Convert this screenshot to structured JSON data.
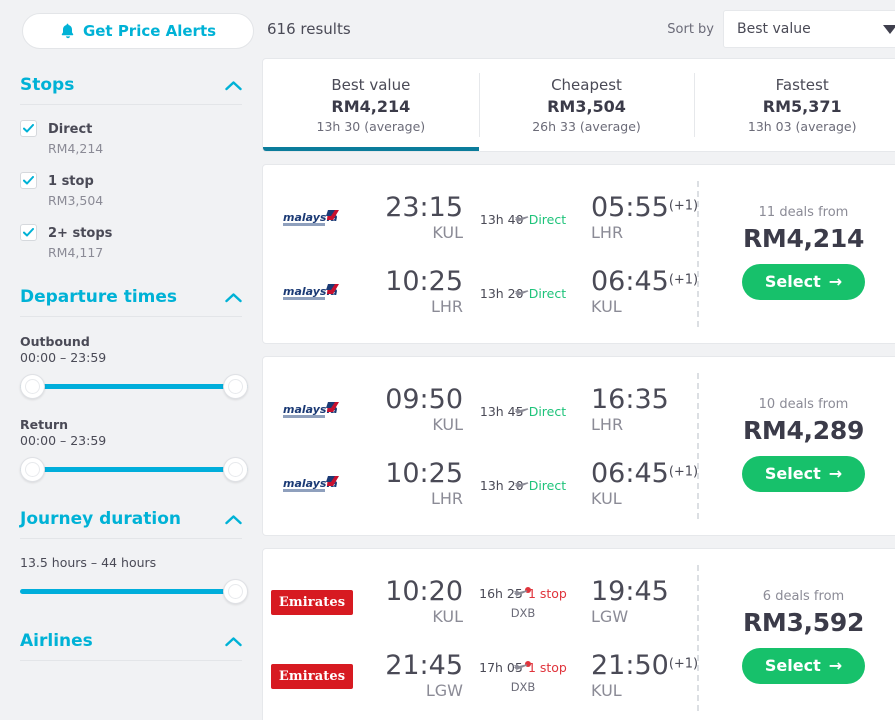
{
  "sidebar": {
    "price_alerts_label": "Get Price Alerts",
    "stops": {
      "title": "Stops",
      "options": [
        {
          "label": "Direct",
          "price": "RM4,214",
          "checked": true
        },
        {
          "label": "1 stop",
          "price": "RM3,504",
          "checked": true
        },
        {
          "label": "2+ stops",
          "price": "RM4,117",
          "checked": true
        }
      ]
    },
    "departure_times": {
      "title": "Departure times",
      "outbound_label": "Outbound",
      "outbound_range": "00:00 – 23:59",
      "return_label": "Return",
      "return_range": "00:00 – 23:59"
    },
    "journey_duration": {
      "title": "Journey duration",
      "range": "13.5 hours – 44 hours"
    },
    "airlines": {
      "title": "Airlines"
    }
  },
  "topbar": {
    "results_count": "616 results",
    "sort_by_label": "Sort by",
    "sort_value": "Best value"
  },
  "tabs": [
    {
      "label": "Best value",
      "price": "RM4,214",
      "duration": "13h 30 (average)",
      "active": true
    },
    {
      "label": "Cheapest",
      "price": "RM3,504",
      "duration": "26h 33 (average)",
      "active": false
    },
    {
      "label": "Fastest",
      "price": "RM5,371",
      "duration": "13h 03 (average)",
      "active": false
    }
  ],
  "results": [
    {
      "legs": [
        {
          "airline": "malaysia-airlines",
          "depart_time": "23:15",
          "depart_code": "KUL",
          "duration": "13h 40",
          "stops": "Direct",
          "stops_type": "direct",
          "via": "",
          "arrive_time": "05:55",
          "arrive_plus": "(+1)",
          "arrive_code": "LHR"
        },
        {
          "airline": "malaysia-airlines",
          "depart_time": "10:25",
          "depart_code": "LHR",
          "duration": "13h 20",
          "stops": "Direct",
          "stops_type": "direct",
          "via": "",
          "arrive_time": "06:45",
          "arrive_plus": "(+1)",
          "arrive_code": "KUL"
        }
      ],
      "deals": "11 deals from",
      "price": "RM4,214",
      "select_label": "Select"
    },
    {
      "legs": [
        {
          "airline": "malaysia-airlines",
          "depart_time": "09:50",
          "depart_code": "KUL",
          "duration": "13h 45",
          "stops": "Direct",
          "stops_type": "direct",
          "via": "",
          "arrive_time": "16:35",
          "arrive_plus": "",
          "arrive_code": "LHR"
        },
        {
          "airline": "malaysia-airlines",
          "depart_time": "10:25",
          "depart_code": "LHR",
          "duration": "13h 20",
          "stops": "Direct",
          "stops_type": "direct",
          "via": "",
          "arrive_time": "06:45",
          "arrive_plus": "(+1)",
          "arrive_code": "KUL"
        }
      ],
      "deals": "10 deals from",
      "price": "RM4,289",
      "select_label": "Select"
    },
    {
      "legs": [
        {
          "airline": "emirates",
          "airline_label": "Emirates",
          "depart_time": "10:20",
          "depart_code": "KUL",
          "duration": "16h 25",
          "stops": "1 stop",
          "stops_type": "stop",
          "via": "DXB",
          "arrive_time": "19:45",
          "arrive_plus": "",
          "arrive_code": "LGW"
        },
        {
          "airline": "emirates",
          "airline_label": "Emirates",
          "depart_time": "21:45",
          "depart_code": "LGW",
          "duration": "17h 05",
          "stops": "1 stop",
          "stops_type": "stop",
          "via": "DXB",
          "arrive_time": "21:50",
          "arrive_plus": "(+1)",
          "arrive_code": "KUL"
        }
      ],
      "deals": "6 deals from",
      "price": "RM3,592",
      "select_label": "Select"
    }
  ],
  "colors": {
    "accent": "#00b2d6",
    "active_tab": "#0b7c9b",
    "select_green": "#17c16b",
    "direct_green": "#1ec37a",
    "stop_red": "#e0343c",
    "emirates_red": "#d71a21",
    "page_bg": "#f1f2f4"
  }
}
